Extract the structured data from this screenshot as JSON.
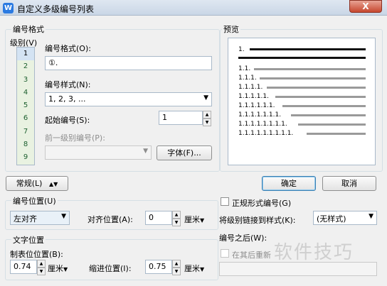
{
  "window": {
    "title": "自定义多级编号列表",
    "app_icon": "W",
    "close": "X"
  },
  "format_group": {
    "title": "编号格式",
    "level_label": "级别(V)",
    "levels": [
      "1",
      "2",
      "3",
      "4",
      "5",
      "6",
      "7",
      "8",
      "9"
    ],
    "selected_level": "1",
    "format_label": "编号格式(O):",
    "format_value": "①.",
    "style_label": "编号样式(N):",
    "style_value": "1, 2, 3, ...",
    "start_label": "起始编号(S):",
    "start_value": "1",
    "prev_level_label": "前一级别编号(P):",
    "font_button": "字体(F)..."
  },
  "preview": {
    "title": "预览",
    "rows": [
      "1.",
      "1.1.",
      "1.1.1.",
      "1.1.1.1.",
      "1.1.1.1.1.",
      "1.1.1.1.1.1.",
      "1.1.1.1.1.1.1.",
      "1.1.1.1.1.1.1.1.",
      "1.1.1.1.1.1.1.1.1."
    ]
  },
  "buttons": {
    "general": "常规(L)",
    "ok": "确定",
    "cancel": "取消"
  },
  "position_group": {
    "title": "编号位置(U)",
    "align_value": "左对齐",
    "align_pos_label": "对齐位置(A):",
    "align_pos_value": "0",
    "align_pos_unit": "厘米"
  },
  "text_group": {
    "title": "文字位置",
    "tab_label": "制表位位置(B):",
    "tab_value": "0.74",
    "tab_unit": "厘米",
    "indent_label": "缩进位置(I):",
    "indent_value": "0.75",
    "indent_unit": "厘米"
  },
  "options": {
    "legal_numbering": "正规形式编号(G)",
    "link_style_label": "将级别链接到样式(K):",
    "link_style_value": "(无样式)",
    "after_number_label": "编号之后(W):",
    "restart_label": "在其后重新"
  },
  "watermark": "软件技巧"
}
